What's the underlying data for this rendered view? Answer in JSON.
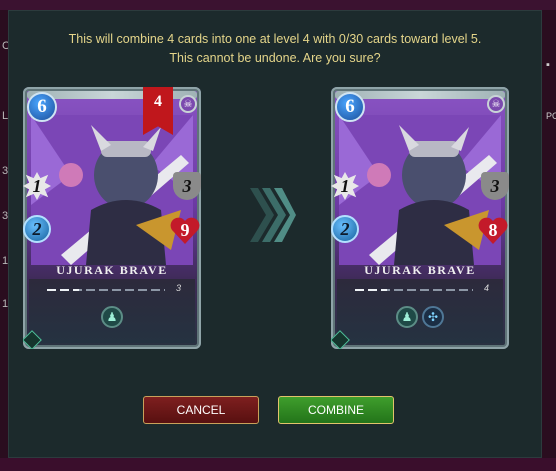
{
  "dialog": {
    "message_line1": "This will combine 4 cards into one at level 4 with 0/30 cards toward level 5.",
    "message_line2": "This cannot be undone. Are you sure?"
  },
  "background": {
    "left_fragments": [
      "L",
      "3",
      "3",
      "1",
      "1"
    ],
    "right_fragments": [
      "▪",
      "PO"
    ],
    "top_left_fragment": "C"
  },
  "cards": [
    {
      "name": "UJURAK BRAVE",
      "level_banner": "4",
      "mana": "6",
      "melee": "1",
      "armor": "3",
      "speed": "2",
      "health": "9",
      "level": "3",
      "level_progress": 0.27,
      "element_icon": "death-element-icon",
      "abilities": [
        "ability-icon"
      ]
    },
    {
      "name": "UJURAK BRAVE",
      "mana": "6",
      "melee": "1",
      "armor": "3",
      "speed": "2",
      "health": "8",
      "level": "4",
      "level_progress": 0.27,
      "element_icon": "death-element-icon",
      "abilities": [
        "ability-icon",
        "ability-icon"
      ]
    }
  ],
  "buttons": {
    "cancel_label": "CANCEL",
    "combine_label": "COMBINE"
  },
  "colors": {
    "message_text": "#e4d58a",
    "cancel_bg": "#7e1f1f",
    "combine_bg": "#3f9e2c",
    "modal_bg": "#1c2a2c"
  }
}
